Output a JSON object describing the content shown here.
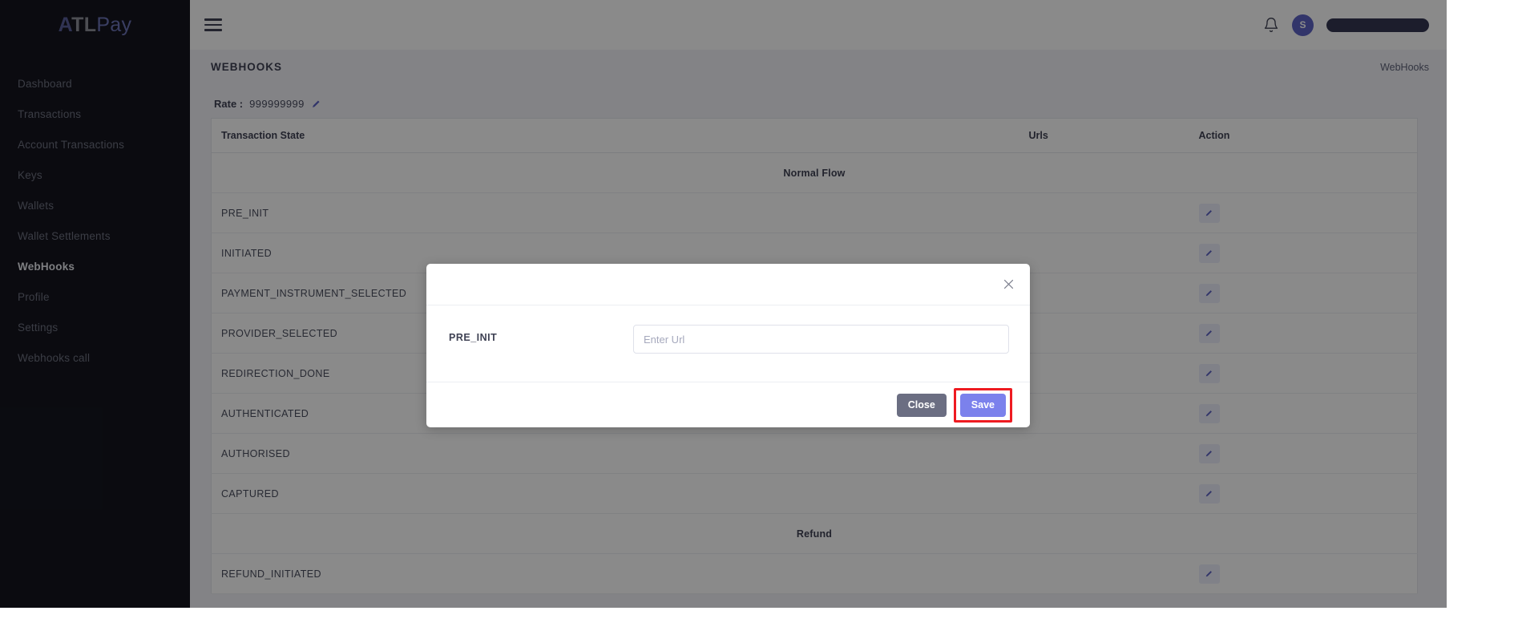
{
  "brand": {
    "logo_part1": "A",
    "logo_part2": "TL",
    "logo_part3": "Pay",
    "accent_indigo": "#5d62c4",
    "sidebar_bg": "#15161f",
    "highlight_red": "#ee1b21"
  },
  "sidebar": {
    "items": [
      {
        "label": "Dashboard",
        "active": false
      },
      {
        "label": "Transactions",
        "active": false
      },
      {
        "label": "Account Transactions",
        "active": false
      },
      {
        "label": "Keys",
        "active": false
      },
      {
        "label": "Wallets",
        "active": false
      },
      {
        "label": "Wallet Settlements",
        "active": false
      },
      {
        "label": "WebHooks",
        "active": true
      },
      {
        "label": "Profile",
        "active": false
      },
      {
        "label": "Settings",
        "active": false
      },
      {
        "label": "Webhooks call",
        "active": false
      }
    ]
  },
  "topbar": {
    "menu_icon": "hamburger-icon",
    "notification_icon": "bell-icon",
    "avatar_initial": "S",
    "username_redacted": ""
  },
  "page": {
    "title": "WEBHOOKS",
    "breadcrumb": "WebHooks"
  },
  "rate": {
    "label": "Rate :",
    "value": "999999999",
    "edit_icon": "pencil-icon"
  },
  "table": {
    "columns": [
      "Transaction State",
      "Urls",
      "Action"
    ],
    "sections": [
      {
        "title": "Normal Flow",
        "rows": [
          {
            "state": "PRE_INIT",
            "url": ""
          },
          {
            "state": "INITIATED",
            "url": ""
          },
          {
            "state": "PAYMENT_INSTRUMENT_SELECTED",
            "url": ""
          },
          {
            "state": "PROVIDER_SELECTED",
            "url": ""
          },
          {
            "state": "REDIRECTION_DONE",
            "url": ""
          },
          {
            "state": "AUTHENTICATED",
            "url": ""
          },
          {
            "state": "AUTHORISED",
            "url": ""
          },
          {
            "state": "CAPTURED",
            "url": ""
          }
        ]
      },
      {
        "title": "Refund",
        "rows": [
          {
            "state": "REFUND_INITIATED",
            "url": ""
          }
        ]
      }
    ]
  },
  "modal": {
    "close_icon": "close-icon",
    "field_label": "PRE_INIT",
    "input_value": "",
    "input_placeholder": "Enter Url",
    "close_button": "Close",
    "save_button": "Save"
  }
}
